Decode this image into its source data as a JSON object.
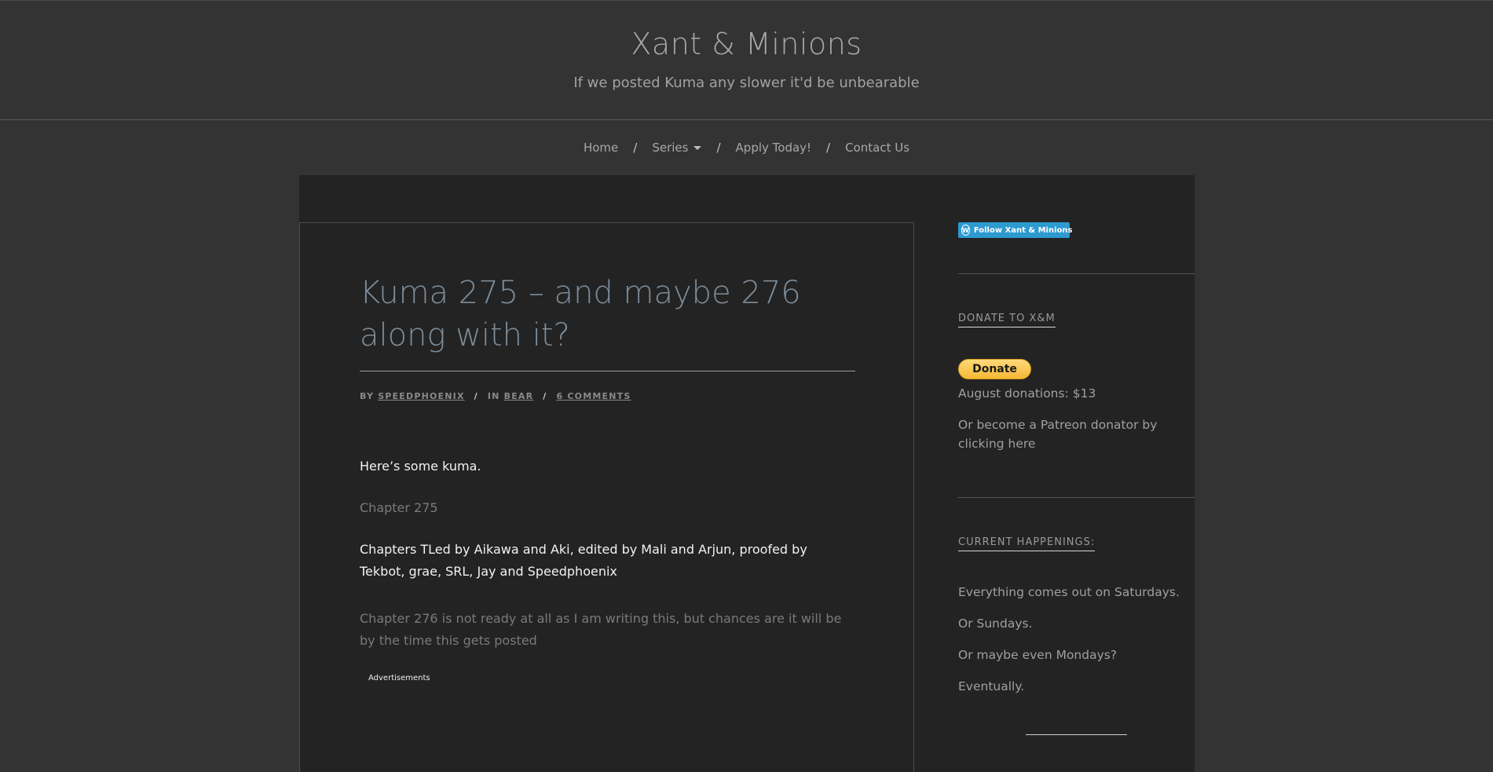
{
  "header": {
    "site_title": "Xant & Minions",
    "tagline": "If we posted Kuma any slower it'd be unbearable"
  },
  "nav": {
    "home": "Home",
    "series": "Series",
    "apply": "Apply Today!",
    "contact": "Contact Us",
    "separator": "/"
  },
  "post": {
    "title": "Kuma 275 – and maybe 276 along with it?",
    "meta": {
      "by_label": "By",
      "author": "SpeedPhoenix",
      "in_label": "In",
      "category": "Bear",
      "comments": "6 Comments",
      "separator": "/"
    },
    "paragraphs": [
      "Here’s some kuma.",
      "Chapter 275",
      "Chapters TLed by Aikawa and Aki, edited by Mali and Arjun, proofed by Tekbot, grae, SRL, Jay and Speedphoenix",
      "Chapter 276 is not ready at all as I am writing this, but chances are it will be by the time this gets posted"
    ],
    "ads_label": "Advertisements"
  },
  "sidebar": {
    "follow_label": "Follow Xant & Minions",
    "donate_title": "DONATE TO X&M",
    "donate_button": "Donate",
    "august_donations": "August donations: $13",
    "patreon_text": "Or become a Patreon donator by clicking here",
    "happenings_title": "CURRENT HAPPENINGS:",
    "happenings": [
      "Everything comes out on Saturdays.",
      "Or Sundays.",
      "Or maybe even Mondays?",
      "Eventually."
    ]
  },
  "colors": {
    "page_bg": "#333333",
    "content_bg": "#232323",
    "post_title": "#7d8c99",
    "follow_button": "#2d9ad0",
    "donate_button": "#f5b935"
  }
}
